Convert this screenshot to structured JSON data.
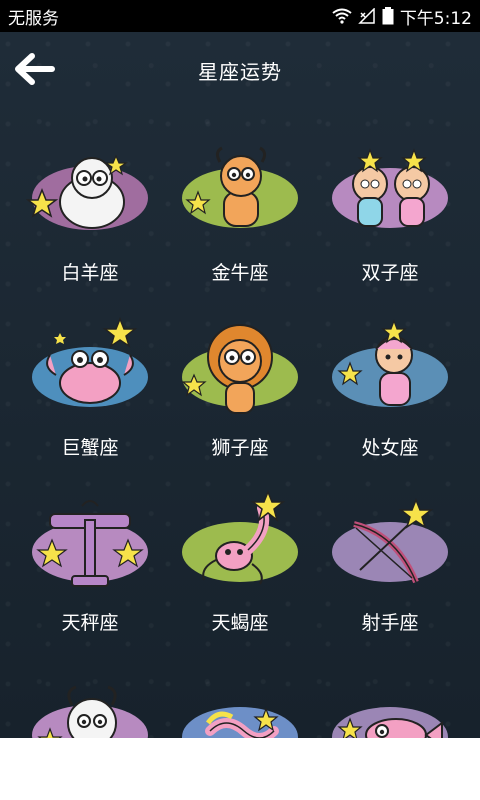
{
  "status_bar": {
    "carrier": "无服务",
    "time": "下午5:12"
  },
  "header": {
    "title": "星座运势"
  },
  "signs": [
    {
      "label": "白羊座",
      "icon": "aries-sheep-icon",
      "blob": "#9c6fa0"
    },
    {
      "label": "金牛座",
      "icon": "taurus-bull-icon",
      "blob": "#9dbb4e"
    },
    {
      "label": "双子座",
      "icon": "gemini-twins-icon",
      "blob": "#b78ac0"
    },
    {
      "label": "巨蟹座",
      "icon": "cancer-crab-icon",
      "blob": "#4e8fbd"
    },
    {
      "label": "狮子座",
      "icon": "leo-lion-icon",
      "blob": "#9dbb4e"
    },
    {
      "label": "处女座",
      "icon": "virgo-girl-icon",
      "blob": "#5b8fb6"
    },
    {
      "label": "天秤座",
      "icon": "libra-scales-icon",
      "blob": "#b78ac0"
    },
    {
      "label": "天蝎座",
      "icon": "scorpio-scorpion-icon",
      "blob": "#9dbb4e"
    },
    {
      "label": "射手座",
      "icon": "sagittarius-bow-icon",
      "blob": "#9b86b5"
    },
    {
      "label": "",
      "icon": "capricorn-goat-icon",
      "blob": "#b78ac0"
    },
    {
      "label": "",
      "icon": "aquarius-icon",
      "blob": "#6d8fc7"
    },
    {
      "label": "",
      "icon": "pisces-fish-icon",
      "blob": "#9b86b5"
    }
  ]
}
